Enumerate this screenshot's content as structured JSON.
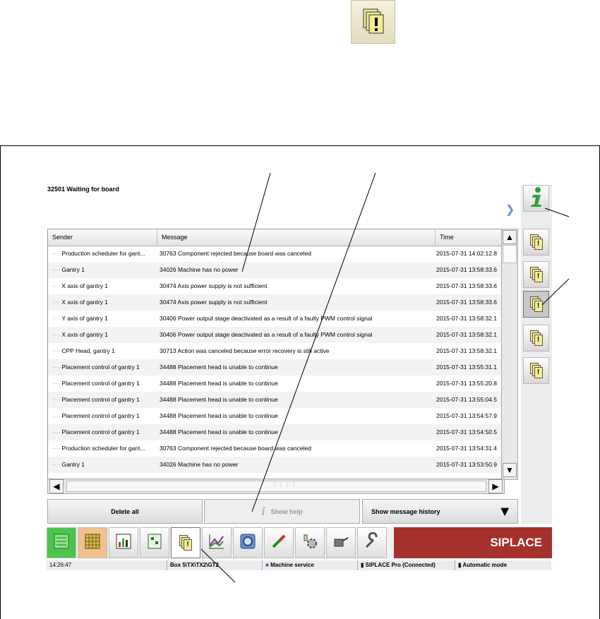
{
  "status_message": "32501 Waiting for board",
  "table": {
    "columns": [
      "Sender",
      "Message",
      "Time"
    ],
    "rows": [
      {
        "sender": "Production scheduler for gant...",
        "message": "30763 Component rejected because board was canceled",
        "time": "2015-07-31 14:02:12.8"
      },
      {
        "sender": "Gantry 1",
        "message": "34026 Machine has no power",
        "time": "2015-07-31 13:58:33.6"
      },
      {
        "sender": "X axis of gantry 1",
        "message": "30474 Axis power supply is not sufficient",
        "time": "2015-07-31 13:58:33.6"
      },
      {
        "sender": "X axis of gantry 1",
        "message": "30474 Axis power supply is not sufficient",
        "time": "2015-07-31 13:58:33.6"
      },
      {
        "sender": "Y axis of gantry 1",
        "message": "30406 Power output stage deactivated as a result of a faulty PWM control signal",
        "time": "2015-07-31 13:58:32.1"
      },
      {
        "sender": "X axis of gantry 1",
        "message": "30406 Power output stage deactivated as a result of a faulty PWM control signal",
        "time": "2015-07-31 13:58:32.1"
      },
      {
        "sender": "CPP Head, gantry 1",
        "message": "30713 Action was canceled because error recovery is still active",
        "time": "2015-07-31 13:58:32.1"
      },
      {
        "sender": "Placement control of gantry 1",
        "message": "34488 Placement head is unable to continue",
        "time": "2015-07-31 13:55:31.1"
      },
      {
        "sender": "Placement control of gantry 1",
        "message": "34488 Placement head is unable to continue",
        "time": "2015-07-31 13:55:20.8"
      },
      {
        "sender": "Placement control of gantry 1",
        "message": "34488 Placement head is unable to continue",
        "time": "2015-07-31 13:55:04.5"
      },
      {
        "sender": "Placement control of gantry 1",
        "message": "34488 Placement head is unable to continue",
        "time": "2015-07-31 13:54:57.9"
      },
      {
        "sender": "Placement control of gantry 1",
        "message": "34488 Placement head is unable to continue",
        "time": "2015-07-31 13:54:50.5"
      },
      {
        "sender": "Production scheduler for gant...",
        "message": "30763 Component rejected because board was canceled",
        "time": "2015-07-31 13:54:31.4"
      },
      {
        "sender": "Gantry 1",
        "message": "34026 Machine has no power",
        "time": "2015-07-31 13:53:50.9"
      }
    ]
  },
  "buttons": {
    "delete_all": "Delete all",
    "show_help": "Show help",
    "show_history": "Show message history"
  },
  "brand": "SIPLACE",
  "statusbar": {
    "time": "14:26:47",
    "box": "Box 5\\TX\\TX2\\GT2",
    "role": "Machine service",
    "connection": "SIPLACE Pro (Connected)",
    "mode": "Automatic mode"
  },
  "colors": {
    "brand_red": "#a5312c",
    "accent_green": "#2aa33a",
    "highlight_orange": "#f2c08a",
    "indicator_blue": "#6a8fd8"
  },
  "icons": {
    "top": "message-stack-icon",
    "right": [
      "info-icon",
      "message-display-icon",
      "message-chart-icon",
      "message-edit-icon",
      "message-bars-icon",
      "message-camera-icon"
    ],
    "nav": [
      "production-icon",
      "feeder-table-icon",
      "statistics-icon",
      "board-icon",
      "messages-icon",
      "chart-icon",
      "camera-icon",
      "nozzle-icon",
      "hand-gear-icon",
      "oil-can-icon",
      "wrench-icon"
    ]
  }
}
